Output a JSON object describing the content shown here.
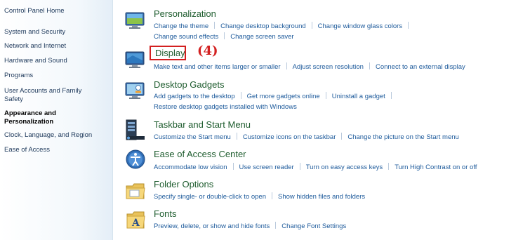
{
  "sidebar": {
    "items": [
      {
        "label": "Control Panel Home"
      },
      {
        "label": "System and Security"
      },
      {
        "label": "Network and Internet"
      },
      {
        "label": "Hardware and Sound"
      },
      {
        "label": "Programs"
      },
      {
        "label": "User Accounts and Family"
      },
      {
        "label": "Safety"
      },
      {
        "label": "Appearance and"
      },
      {
        "label": "Personalization"
      },
      {
        "label": "Clock, Language, and Region"
      },
      {
        "label": "Ease of Access"
      }
    ]
  },
  "categories": [
    {
      "title": "Personalization",
      "icon": "personalization-icon",
      "links": [
        "Change the theme",
        "Change desktop background",
        "Change window glass colors",
        "Change sound effects",
        "Change screen saver"
      ]
    },
    {
      "title": "Display",
      "icon": "display-icon",
      "links": [
        "Make text and other items larger or smaller",
        "Adjust screen resolution",
        "Connect to an external display"
      ]
    },
    {
      "title": "Desktop Gadgets",
      "icon": "desktop-gadgets-icon",
      "links": [
        "Add gadgets to the desktop",
        "Get more gadgets online",
        "Uninstall a gadget",
        "Restore desktop gadgets installed with Windows"
      ]
    },
    {
      "title": "Taskbar and Start Menu",
      "icon": "taskbar-icon",
      "links": [
        "Customize the Start menu",
        "Customize icons on the taskbar",
        "Change the picture on the Start menu"
      ]
    },
    {
      "title": "Ease of Access Center",
      "icon": "ease-of-access-icon",
      "links": [
        "Accommodate low vision",
        "Use screen reader",
        "Turn on easy access keys",
        "Turn High Contrast on or off"
      ]
    },
    {
      "title": "Folder Options",
      "icon": "folder-options-icon",
      "links": [
        "Specify single- or double-click to open",
        "Show hidden files and folders"
      ]
    },
    {
      "title": "Fonts",
      "icon": "fonts-icon",
      "links": [
        "Preview, delete, or show and hide fonts",
        "Change Font Settings"
      ]
    }
  ],
  "annotation": {
    "label": "(4)",
    "color": "#d32020"
  }
}
